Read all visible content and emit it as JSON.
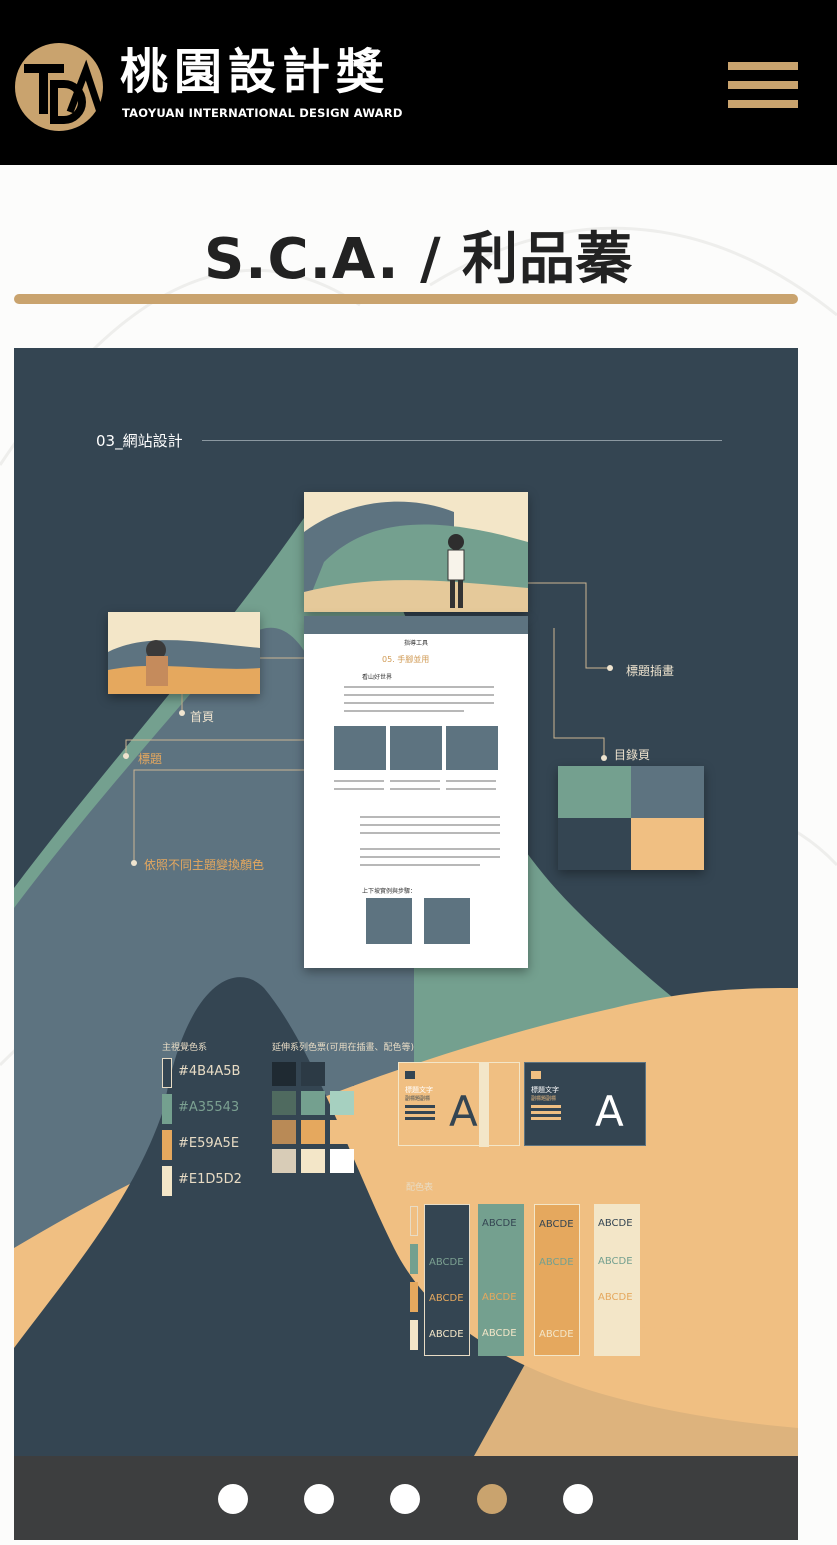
{
  "header": {
    "brand_zh": "桃園設計獎",
    "brand_en": "TAOYUAN INTERNATIONAL DESIGN AWARD",
    "logo_letters": "TDA",
    "menu_icon": "hamburger-menu-icon",
    "accent": "#c9a36e"
  },
  "page": {
    "title": "S.C.A. / 利品蓁"
  },
  "slide": {
    "section": "03_網站設計",
    "annotations": {
      "home": "首頁",
      "title_label": "標題",
      "title_illustration": "標題插畫",
      "toc_page": "目錄頁",
      "theme_color": "依照不同主題變換顏色"
    },
    "mock_article": {
      "nav": "指導工具",
      "heading": "05. 手腳並用",
      "subheading": "看山好世界",
      "footer_note": "上下坡實例與步驟："
    },
    "palette": {
      "main_label": "主視覺色系",
      "sub_label": "延伸系列色票(可用在插畫、配色等)",
      "pairing_label": "配色表",
      "swatches": [
        {
          "hex": "#4B4A5B",
          "color": "#4B4A5B"
        },
        {
          "hex": "#A35543",
          "color": "#7ba091"
        },
        {
          "hex": "#E59A5E",
          "color": "#e5a85e"
        },
        {
          "hex": "#E1D5D2",
          "color": "#f3e6c8"
        }
      ],
      "type_sample_title": "標題文字",
      "type_sample_sub": "副標題副標",
      "type_letter": "A",
      "pairing_word": "ABCDE",
      "pairing_sub": "ABCDE"
    }
  },
  "pager": {
    "count": 5,
    "active_index": 3
  }
}
